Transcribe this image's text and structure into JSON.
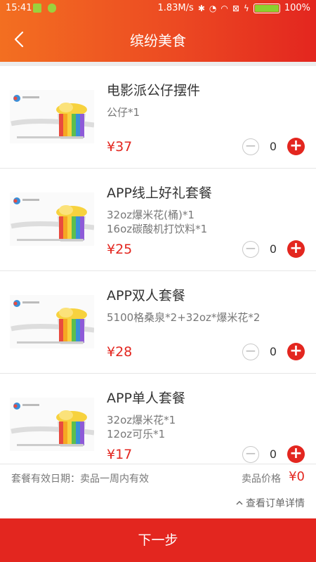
{
  "status_bar": {
    "time": "15:41",
    "speed": "1.83M/s",
    "battery": "100%"
  },
  "header": {
    "title": "缤纷美食"
  },
  "products": [
    {
      "name": "电影派公仔摆件",
      "desc": [
        "公仔*1"
      ],
      "price": "¥37",
      "qty": "0"
    },
    {
      "name": "APP线上好礼套餐",
      "desc": [
        "32oz爆米花(桶)*1",
        "16oz碳酸机打饮料*1"
      ],
      "price": "¥25",
      "qty": "0"
    },
    {
      "name": "APP双人套餐",
      "desc": [
        "5100格桑泉*2+32oz*爆米花*2"
      ],
      "price": "¥28",
      "qty": "0"
    },
    {
      "name": "APP单人套餐",
      "desc": [
        "32oz爆米花*1",
        "12oz可乐*1"
      ],
      "price": "¥17",
      "qty": "0"
    }
  ],
  "summary": {
    "validity": "套餐有效日期：卖品一周内有效",
    "price_label": "卖品价格",
    "total": "¥0",
    "details_label": "查看订单详情"
  },
  "footer": {
    "next_label": "下一步"
  },
  "colors": {
    "accent": "#e3261f",
    "header_start": "#f36f21"
  }
}
